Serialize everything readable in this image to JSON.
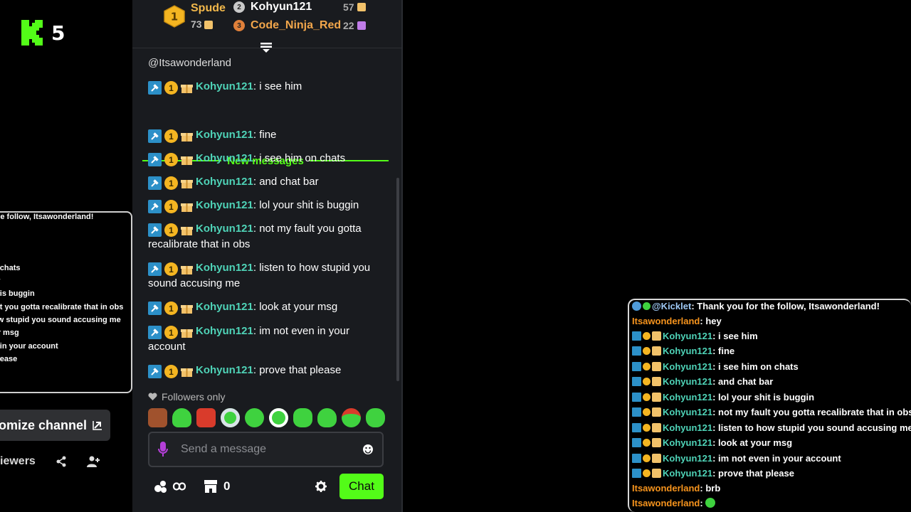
{
  "logo": {
    "text": "5",
    "brand_color": "#53fc18"
  },
  "left_overlay": {
    "lines": [
      "the follow, Itsawonderland!",
      "n chats",
      "ar",
      "it is buggin",
      "ult you gotta recalibrate that in obs",
      "ow stupid you sound accusing me",
      "ur msg",
      "n in your account",
      "please"
    ],
    "customize_label": "omize channel",
    "viewers_label": "iewers"
  },
  "leaderboard": {
    "first": {
      "rank": "1",
      "name": "Spude",
      "count": "73"
    },
    "second": {
      "rank": "2",
      "name": "Kohyun121",
      "count": "57"
    },
    "third": {
      "rank": "3",
      "name": "Code_Ninja_Red",
      "count": "22"
    }
  },
  "chat": {
    "top_mention": "@Itsawonderland",
    "new_messages_label": "New messages",
    "messages": [
      {
        "user": "Kohyun121",
        "text": "i see him"
      },
      {
        "user": "Kohyun121",
        "text": "fine"
      },
      {
        "user": "Kohyun121",
        "text": "i see him on chats"
      },
      {
        "user": "Kohyun121",
        "text": "and chat bar"
      },
      {
        "user": "Kohyun121",
        "text": "lol your shit is buggin"
      },
      {
        "user": "Kohyun121",
        "text": "not my fault you gotta recalibrate that in obs"
      },
      {
        "user": "Kohyun121",
        "text": "listen to how stupid you sound accusing me"
      },
      {
        "user": "Kohyun121",
        "text": "look at your msg"
      },
      {
        "user": "Kohyun121",
        "text": "im not even in your account"
      },
      {
        "user": "Kohyun121",
        "text": "prove that please"
      }
    ],
    "coin_badge": "1",
    "followers_only": "Followers only",
    "send_placeholder": "Send a message",
    "points_value": "0",
    "chat_button": "Chat",
    "accent_color": "#53fc18",
    "username_color": "#4fd4b8"
  },
  "right_overlay": {
    "kicklet_name": "@Kicklet",
    "kicklet_text": "Thank you for the follow, Itsawonderland!",
    "lines": [
      {
        "user": "Itsawonderland",
        "text": "hey",
        "badges": false,
        "color": "orange"
      },
      {
        "user": "Kohyun121",
        "text": "i see him",
        "badges": true,
        "color": "teal"
      },
      {
        "user": "Kohyun121",
        "text": "fine",
        "badges": true,
        "color": "teal"
      },
      {
        "user": "Kohyun121",
        "text": "i see him on chats",
        "badges": true,
        "color": "teal"
      },
      {
        "user": "Kohyun121",
        "text": "and chat bar",
        "badges": true,
        "color": "teal"
      },
      {
        "user": "Kohyun121",
        "text": "lol your shit is buggin",
        "badges": true,
        "color": "teal"
      },
      {
        "user": "Kohyun121",
        "text": "not my fault you gotta recalibrate that in obs",
        "badges": true,
        "color": "teal"
      },
      {
        "user": "Kohyun121",
        "text": "listen to how stupid you sound accusing me",
        "badges": true,
        "color": "teal"
      },
      {
        "user": "Kohyun121",
        "text": "look at your msg",
        "badges": true,
        "color": "teal"
      },
      {
        "user": "Kohyun121",
        "text": "im not even in your account",
        "badges": true,
        "color": "teal"
      },
      {
        "user": "Kohyun121",
        "text": "prove that please",
        "badges": true,
        "color": "teal"
      },
      {
        "user": "Itsawonderland",
        "text": "brb",
        "badges": false,
        "color": "orange"
      },
      {
        "user": "Itsawonderland",
        "text": "",
        "badges": false,
        "color": "orange"
      }
    ]
  }
}
